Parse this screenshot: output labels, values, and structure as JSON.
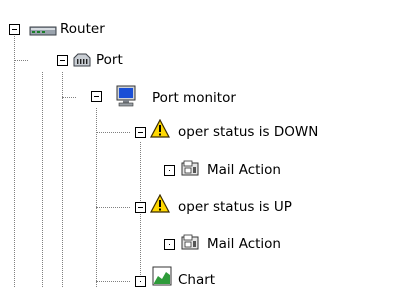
{
  "tree": {
    "router": {
      "label": "Router",
      "icon": "router-icon"
    },
    "port": {
      "label": "Port",
      "icon": "network-port-icon"
    },
    "port_monitor": {
      "label": "Port monitor",
      "icon": "monitor-icon"
    },
    "rule_down": {
      "label": "oper status is DOWN",
      "icon": "warning-icon"
    },
    "mail_action_1": {
      "label": "Mail Action",
      "icon": "mail-action-icon"
    },
    "rule_up": {
      "label": "oper status is UP",
      "icon": "warning-icon"
    },
    "mail_action_2": {
      "label": "Mail Action",
      "icon": "mail-action-icon"
    },
    "chart": {
      "label": "Chart",
      "icon": "chart-icon"
    }
  },
  "colors": {
    "warning": "#ffd800",
    "chart_green": "#2e9b3a",
    "monitor_blue": "#1a4fd6"
  }
}
